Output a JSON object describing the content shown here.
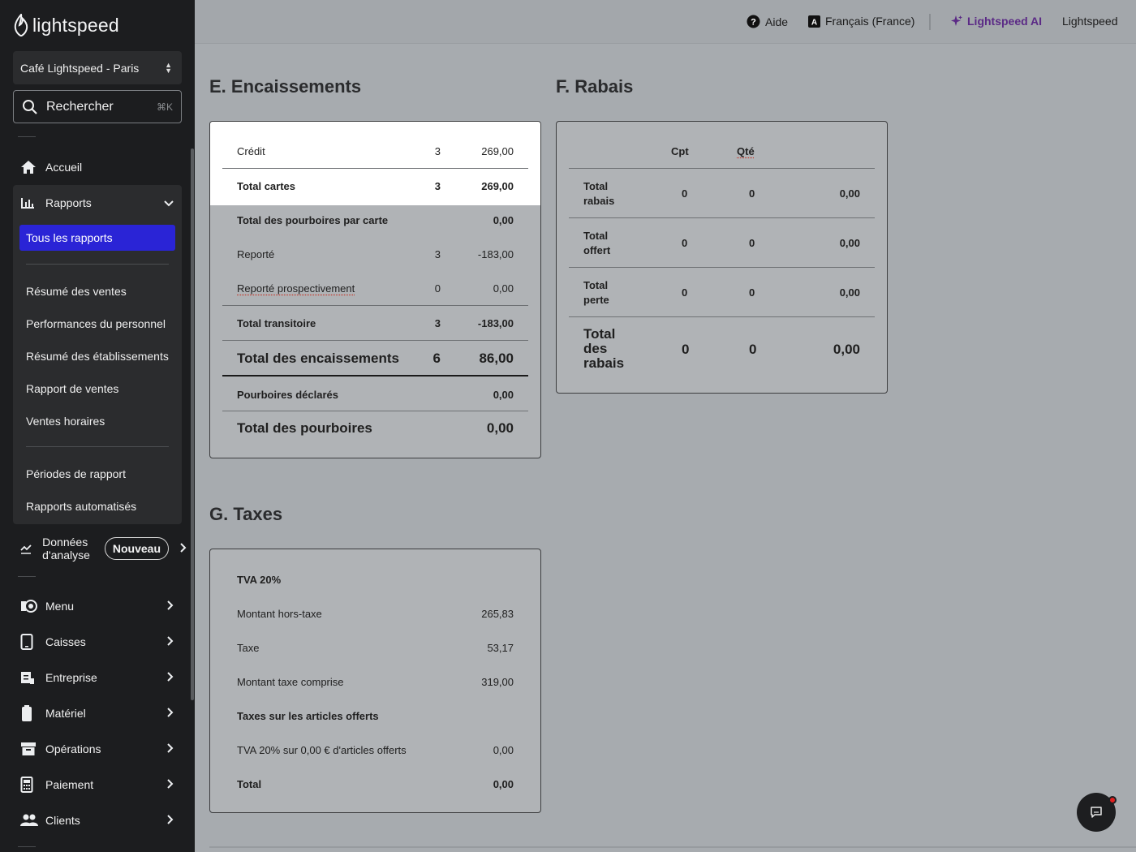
{
  "brand": {
    "name": "lightspeed"
  },
  "sidebar": {
    "store": "Café Lightspeed - Paris",
    "search": {
      "label": "Rechercher",
      "shortcut": "⌘K"
    },
    "home": "Accueil",
    "reports": {
      "label": "Rapports",
      "active": "Tous les rapports",
      "items": [
        "Résumé des ventes",
        "Performances du personnel",
        "Résumé des établissements",
        "Rapport de ventes",
        "Ventes horaires"
      ],
      "items2": [
        "Périodes de rapport",
        "Rapports automatisés"
      ]
    },
    "analytics": {
      "line1": "Données",
      "line2": "d'analyse",
      "badge": "Nouveau"
    },
    "nav": [
      "Menu",
      "Caisses",
      "Entreprise",
      "Matériel",
      "Opérations",
      "Paiement",
      "Clients"
    ]
  },
  "topbar": {
    "help": "Aide",
    "language": "Français (France)",
    "ai": "Lightspeed AI",
    "account": "Lightspeed"
  },
  "encaissements": {
    "title": "E. Encaissements",
    "rows": [
      {
        "label": "Crédit",
        "count": "3",
        "value": "269,00"
      },
      {
        "label": "Total cartes",
        "count": "3",
        "value": "269,00"
      },
      {
        "label": "Total des pourboires par carte",
        "count": "",
        "value": "0,00"
      },
      {
        "label": "Reporté",
        "count": "3",
        "value": "-183,00"
      },
      {
        "label": "Reporté prospectivement",
        "count": "0",
        "value": "0,00"
      },
      {
        "label": "Total transitoire",
        "count": "3",
        "value": "-183,00"
      },
      {
        "label": "Total des encaissements",
        "count": "6",
        "value": "86,00"
      },
      {
        "label": "Pourboires déclarés",
        "count": "",
        "value": "0,00"
      },
      {
        "label": "Total des pourboires",
        "count": "",
        "value": "0,00"
      }
    ]
  },
  "rabais": {
    "title": "F. Rabais",
    "headers": {
      "count": "Cpt",
      "qty": "Qté"
    },
    "rows": [
      {
        "line1": "Total",
        "line2": "rabais",
        "line3": "",
        "count": "0",
        "qty": "0",
        "value": "0,00"
      },
      {
        "line1": "Total",
        "line2": "offert",
        "line3": "",
        "count": "0",
        "qty": "0",
        "value": "0,00"
      },
      {
        "line1": "Total",
        "line2": "perte",
        "line3": "",
        "count": "0",
        "qty": "0",
        "value": "0,00"
      },
      {
        "line1": "Total",
        "line2": "des",
        "line3": "rabais",
        "count": "0",
        "qty": "0",
        "value": "0,00"
      }
    ]
  },
  "taxes": {
    "title": "G. Taxes",
    "rows": [
      {
        "label": "TVA 20%",
        "value": ""
      },
      {
        "label": "Montant hors-taxe",
        "value": "265,83"
      },
      {
        "label": "Taxe",
        "value": "53,17"
      },
      {
        "label": "Montant taxe comprise",
        "value": "319,00"
      },
      {
        "label": "Taxes sur les articles offerts",
        "value": ""
      },
      {
        "label": "TVA 20% sur 0,00 € d'articles offerts",
        "value": "0,00"
      },
      {
        "label": "Total",
        "value": "0,00"
      }
    ]
  },
  "colors": {
    "sidebar": "#1c1d1f",
    "accent": "#2a24d6",
    "ai": "#5b2a86"
  }
}
